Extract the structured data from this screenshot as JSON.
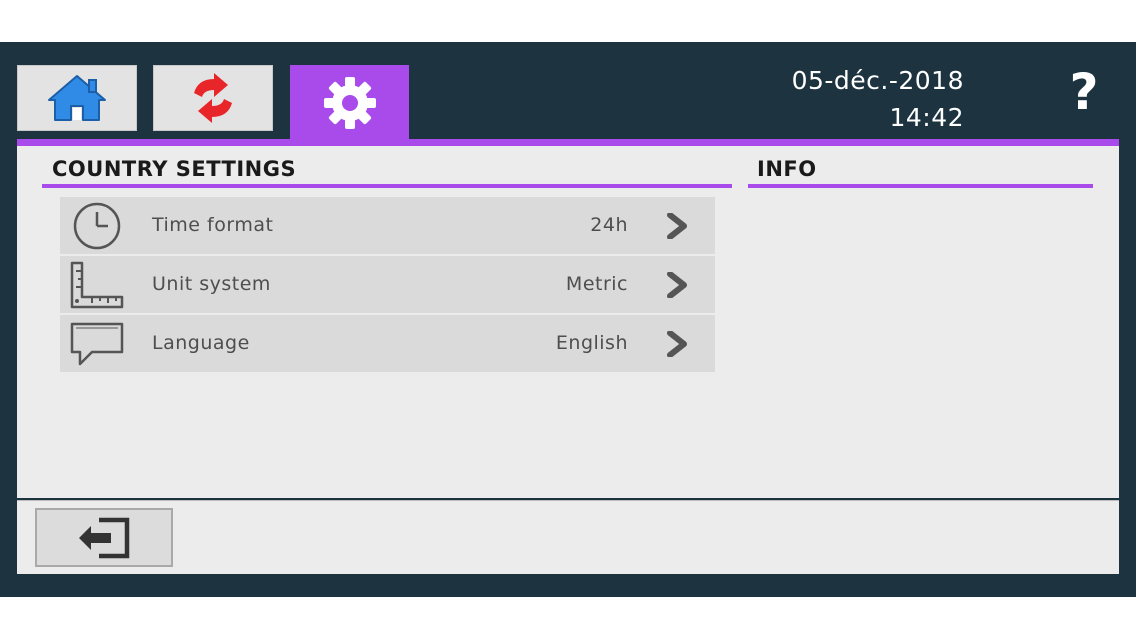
{
  "tabs": [
    {
      "name": "home",
      "icon": "home-icon",
      "color": "#2f8be6"
    },
    {
      "name": "sync",
      "icon": "sync-icon",
      "color": "#e8262a"
    },
    {
      "name": "settings",
      "icon": "gear-icon",
      "active": true,
      "color": "#a84bea"
    }
  ],
  "header": {
    "date": "05-déc.-2018",
    "time": "14:42",
    "help_label": "?"
  },
  "country_settings": {
    "title": "COUNTRY SETTINGS",
    "items": [
      {
        "icon": "clock-icon",
        "label": "Time format",
        "value": "24h"
      },
      {
        "icon": "ruler-icon",
        "label": "Unit system",
        "value": "Metric"
      },
      {
        "icon": "speech-bubble-icon",
        "label": "Language",
        "value": "English"
      }
    ]
  },
  "info": {
    "title": "INFO"
  },
  "footer": {
    "back_icon": "exit-icon"
  },
  "colors": {
    "accent": "#a84bea",
    "frame": "#1d3340",
    "panel": "#ececec",
    "row": "#dadada"
  }
}
